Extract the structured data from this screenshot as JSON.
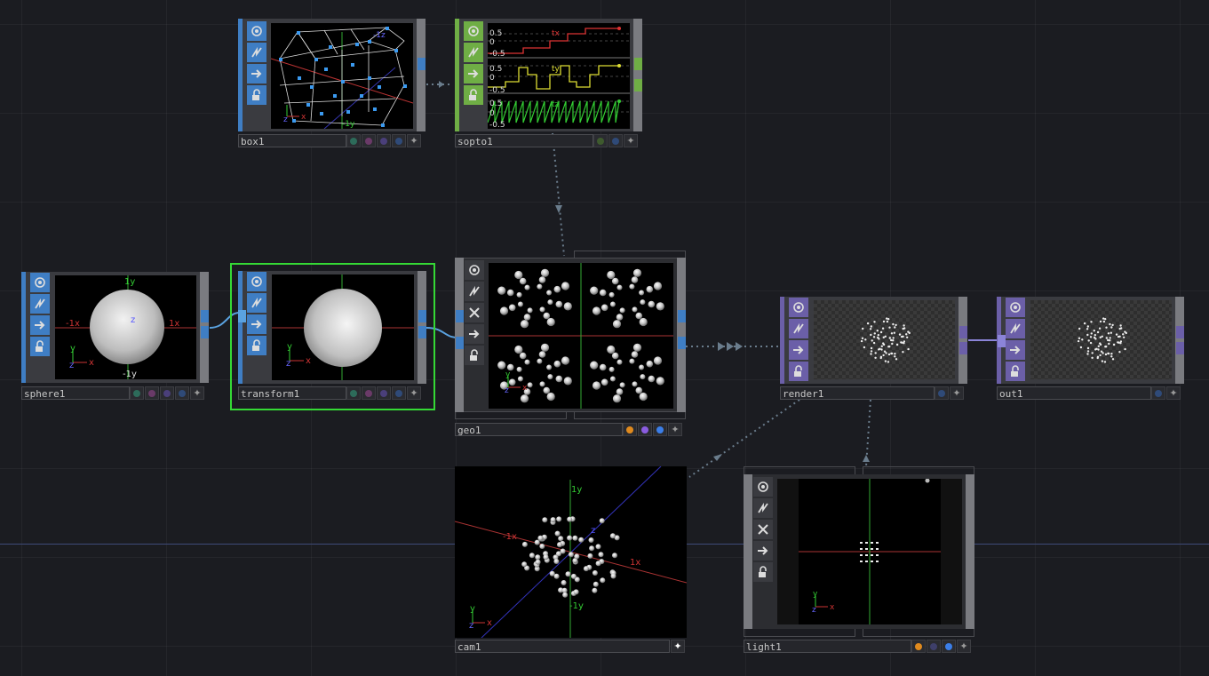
{
  "colors": {
    "sop_blue": "#3f7ec4",
    "chop_green": "#6fae45",
    "comp_gray": "#7d7e82",
    "top_purple": "#6b5fa8",
    "select_green": "#35d935"
  },
  "nodes": {
    "box1": {
      "name": "box1",
      "axis_x": "x",
      "axis_y": "y",
      "axis_z": "z",
      "tick_y": "-1y",
      "tick_z": "-1z"
    },
    "sopto1": {
      "name": "sopto1",
      "channels": [
        {
          "name": "tx",
          "hi": "0.5",
          "mid": "0",
          "lo": "-0.5"
        },
        {
          "name": "ty",
          "hi": "0.5",
          "mid": "0",
          "lo": "-0.5"
        },
        {
          "name": "tz",
          "hi": "0.5",
          "mid": "0",
          "lo": "-0.5"
        }
      ]
    },
    "sphere1": {
      "name": "sphere1",
      "pos_y": "1y",
      "neg_y": "-1y",
      "pos_x": "1x",
      "neg_x": "-1x",
      "z": "z",
      "axis_x": "x",
      "axis_y": "y",
      "axis_z": "z"
    },
    "transform1": {
      "name": "transform1",
      "axis_x": "x",
      "axis_y": "y",
      "axis_z": "z"
    },
    "geo1": {
      "name": "geo1",
      "axis_x": "x",
      "axis_y": "y",
      "axis_z": "z"
    },
    "render1": {
      "name": "render1"
    },
    "out1": {
      "name": "out1"
    },
    "cam1": {
      "name": "cam1",
      "pos_y": "1y",
      "neg_y": "-1y",
      "pos_x": "1x",
      "neg_x": "-1x",
      "z": "z",
      "axis_x": "x",
      "axis_y": "y",
      "axis_z": "z"
    },
    "light1": {
      "name": "light1",
      "axis_x": "x",
      "axis_y": "y",
      "axis_z": "z"
    }
  },
  "icons": {
    "viewer": "viewer-icon",
    "bypass": "bypass-icon",
    "display": "display-icon",
    "lock": "lock-icon",
    "disable": "disable-icon",
    "plus": "plus-icon"
  }
}
